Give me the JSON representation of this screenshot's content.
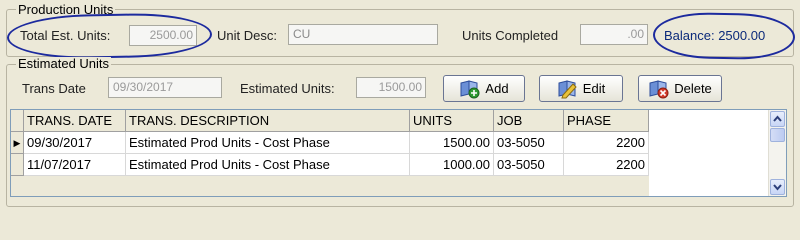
{
  "production_units": {
    "legend": "Production Units",
    "total_est_label": "Total Est. Units:",
    "total_est_value": "2500.00",
    "unit_desc_label": "Unit Desc:",
    "unit_desc_value": "CU",
    "units_completed_label": "Units Completed",
    "units_completed_value": ".00",
    "balance_text": "Balance: 2500.00"
  },
  "estimated_units": {
    "legend": "Estimated Units",
    "trans_date_label": "Trans Date",
    "trans_date_value": "09/30/2017",
    "est_units_label": "Estimated Units:",
    "est_units_value": "1500.00",
    "add_label": "Add",
    "edit_label": "Edit",
    "delete_label": "Delete"
  },
  "grid": {
    "columns": [
      "TRANS. DATE",
      "TRANS. DESCRIPTION",
      "UNITS",
      "JOB",
      "PHASE"
    ],
    "rows": [
      [
        "09/30/2017",
        "Estimated Prod Units - Cost Phase",
        "1500.00",
        "03-5050",
        "2200"
      ],
      [
        "11/07/2017",
        "Estimated Prod Units - Cost Phase",
        "1000.00",
        "03-5050",
        "2200"
      ]
    ],
    "current_row_marker": "▶"
  },
  "annotation_color": "#1c2a9e"
}
